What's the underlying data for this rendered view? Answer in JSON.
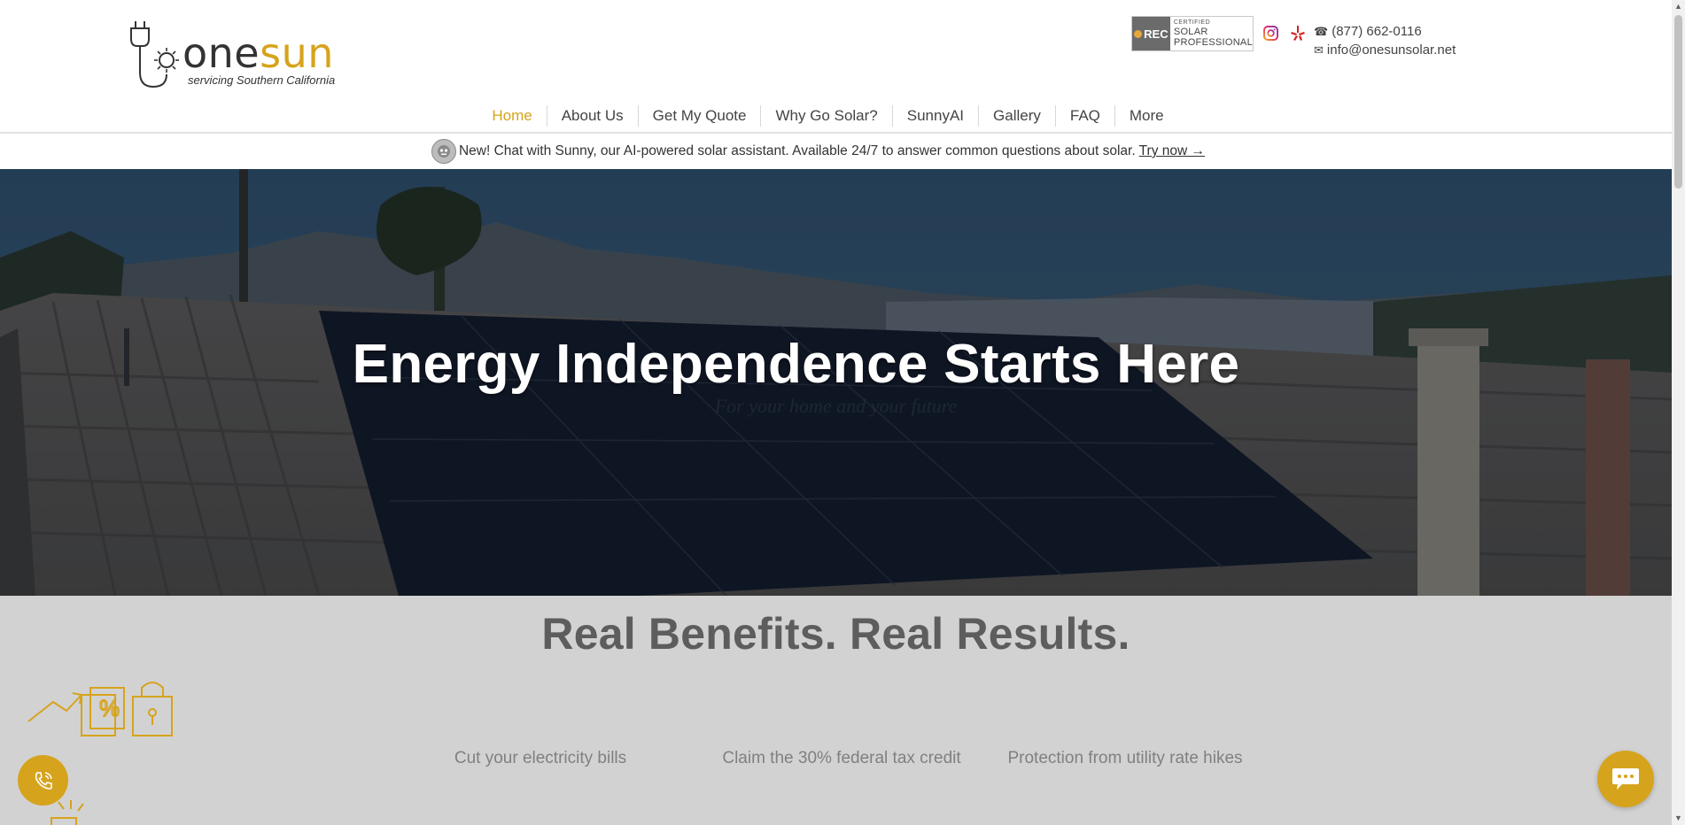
{
  "brand": {
    "word_one": "one",
    "word_sun": "sun",
    "tagline": "servicing Southern California",
    "accent_color": "#d6a31c"
  },
  "certification": {
    "rec": "REC",
    "line1": "CERTIFIED",
    "line2": "SOLAR",
    "line3": "PROFESSIONAL"
  },
  "social": [
    {
      "name": "instagram-icon"
    },
    {
      "name": "yelp-icon"
    }
  ],
  "contact": {
    "phone": "(877) 662-0116",
    "email": "info@onesunsolar.net"
  },
  "nav": {
    "items": [
      {
        "label": "Home",
        "active": true
      },
      {
        "label": "About Us"
      },
      {
        "label": "Get My Quote"
      },
      {
        "label": "Why Go Solar?"
      },
      {
        "label": "SunnyAI"
      },
      {
        "label": "Gallery"
      },
      {
        "label": "FAQ"
      },
      {
        "label": "More"
      }
    ]
  },
  "announcement": {
    "text": "New! Chat with Sunny, our AI-powered solar assistant. Available 24/7 to answer common questions about solar.",
    "link": "Try now →"
  },
  "hero": {
    "title": "Energy Independence Starts Here",
    "subtitle": "For your home and your future"
  },
  "benefits": {
    "title": "Real Benefits. Real Results.",
    "items": [
      "Cut your electricity bills",
      "Claim the 30% federal tax credit",
      "Protection from utility rate hikes"
    ]
  }
}
